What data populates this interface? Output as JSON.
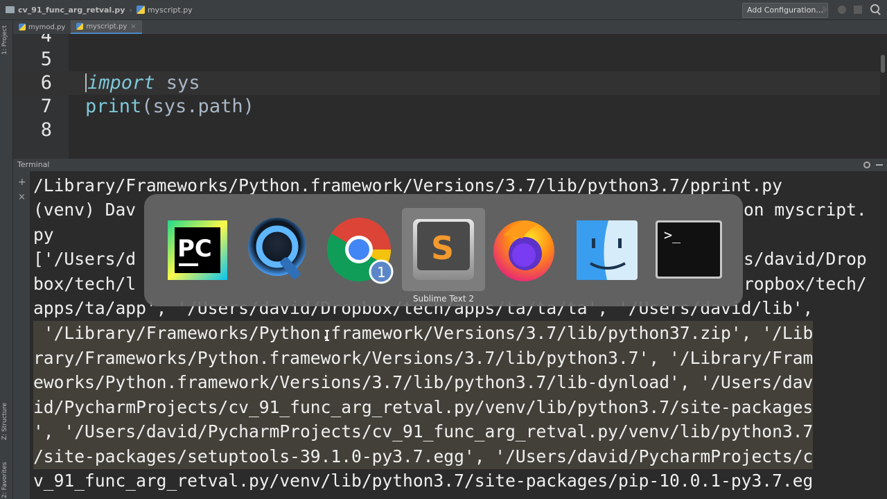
{
  "navbar": {
    "project_folder": "cv_91_func_arg_retval.py",
    "current_file": "myscript.py",
    "add_config_label": "Add Configuration..."
  },
  "left_strip": {
    "project_label": "1: Project",
    "structure_label": "Z: Structure",
    "favorites_label": "2: Favorites"
  },
  "tabs": [
    {
      "label": "mymod.py"
    },
    {
      "label": "myscript.py",
      "close": "×"
    }
  ],
  "editor": {
    "lines": [
      {
        "number": "4",
        "code": ""
      },
      {
        "number": "5",
        "code": ""
      },
      {
        "number": "6",
        "keyword": "import",
        "rest": " sys"
      },
      {
        "number": "7",
        "func": "print",
        "rest": "(sys.path)"
      },
      {
        "number": "8",
        "code": ""
      }
    ]
  },
  "terminal": {
    "title": "Terminal",
    "plus": "+",
    "close": "×",
    "lines": [
      "/Library/Frameworks/Python.framework/Versions/3.7/lib/python3.7/pprint.py",
      "(venv) Dav",
      "on myscript.",
      "py",
      "['/Users/d",
      "s/david/Drop",
      "box/tech/l",
      "ropbox/tech/",
      "apps/ta/app', '/Users/david/Dropbox/tech/apps/ta/ta/ta', '/Users/david/lib',",
      " '/Library/Frameworks/Python.framework/Versions/3.7/lib/python37.zip', '/Lib",
      "rary/Frameworks/Python.framework/Versions/3.7/lib/python3.7', '/Library/Fram",
      "eworks/Python.framework/Versions/3.7/lib/python3.7/lib-dynload', '/Users/dav",
      "id/PycharmProjects/cv_91_func_arg_retval.py/venv/lib/python3.7/site-packages",
      "', '/Users/david/PycharmProjects/cv_91_func_arg_retval.py/venv/lib/python3.7",
      "/site-packages/setuptools-39.1.0-py3.7.egg', '/Users/david/PycharmProjects/c",
      "v_91_func_arg_retval.py/venv/lib/python3.7/site-packages/pip-10.0.1-py3.7.eg"
    ]
  },
  "switcher": {
    "apps": [
      {
        "name": "pycharm-icon",
        "glyph": "PC"
      },
      {
        "name": "quicktime-icon"
      },
      {
        "name": "chrome-icon",
        "badge": "1"
      },
      {
        "name": "sublime-text-icon",
        "glyph": "S"
      },
      {
        "name": "firefox-icon"
      },
      {
        "name": "finder-icon"
      },
      {
        "name": "terminal-app-icon",
        "glyph": ">_"
      }
    ],
    "selected_label": "Sublime Text 2"
  },
  "colors": {
    "background": "#2b2b2b",
    "keyword": "#7ec8d8",
    "accent": "#4a88c7"
  }
}
